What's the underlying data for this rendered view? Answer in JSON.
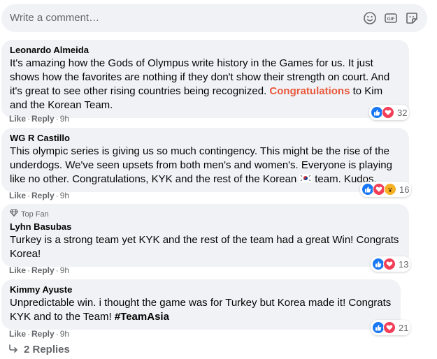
{
  "composer": {
    "placeholder": "Write a comment…",
    "icons": [
      "emoji-icon",
      "gif-icon",
      "sticker-icon"
    ]
  },
  "comments": [
    {
      "author": "Leonardo Almeida",
      "text_before": "It's amazing how the Gods of Olympus write history in the Games for us. It just shows how the favorites are nothing if they don't show their strength on court. And it's great to see other rising countries being recognized.",
      "highlight": "Congratulations",
      "text_after": "to Kim and the Korean Team.",
      "like": "Like",
      "reply": "Reply",
      "time": "9h",
      "reaction_count": "32",
      "reactions": [
        "like",
        "love"
      ]
    },
    {
      "author": "WG R Castillo",
      "text_before": "This olympic series is giving us so much contingency. This might be the rise of the underdogs. We've seen upsets from both men's and women's. Everyone is playing like no other. Congratulations, KYK and the rest of the Korean",
      "text_after": "team. Kudos.",
      "like": "Like",
      "reply": "Reply",
      "time": "9h",
      "reaction_count": "16",
      "reactions": [
        "like",
        "love",
        "wow"
      ]
    },
    {
      "badge": "Top Fan",
      "author": "Lyhn Basubas",
      "text": "Turkey is a strong team yet KYK and the rest of the team had a great Win! Congrats Korea!",
      "like": "Like",
      "reply": "Reply",
      "time": "9h",
      "reaction_count": "13",
      "reactions": [
        "like",
        "love"
      ]
    },
    {
      "author": "Kimmy Ayuste",
      "text": "Unpredictable win. i thought the game was for Turkey but Korea made it! Congrats KYK and to the Team!",
      "hashtag": "#TeamAsia",
      "like": "Like",
      "reply": "Reply",
      "time": "9h",
      "reaction_count": "21",
      "reactions": [
        "like",
        "love"
      ]
    }
  ],
  "replies_link": "2 Replies",
  "colors": {
    "bubble": "#f0f2f5",
    "highlight": "#e9593d",
    "like": "#1877f2",
    "love": "#f33e58",
    "wow": "#f7b125"
  }
}
